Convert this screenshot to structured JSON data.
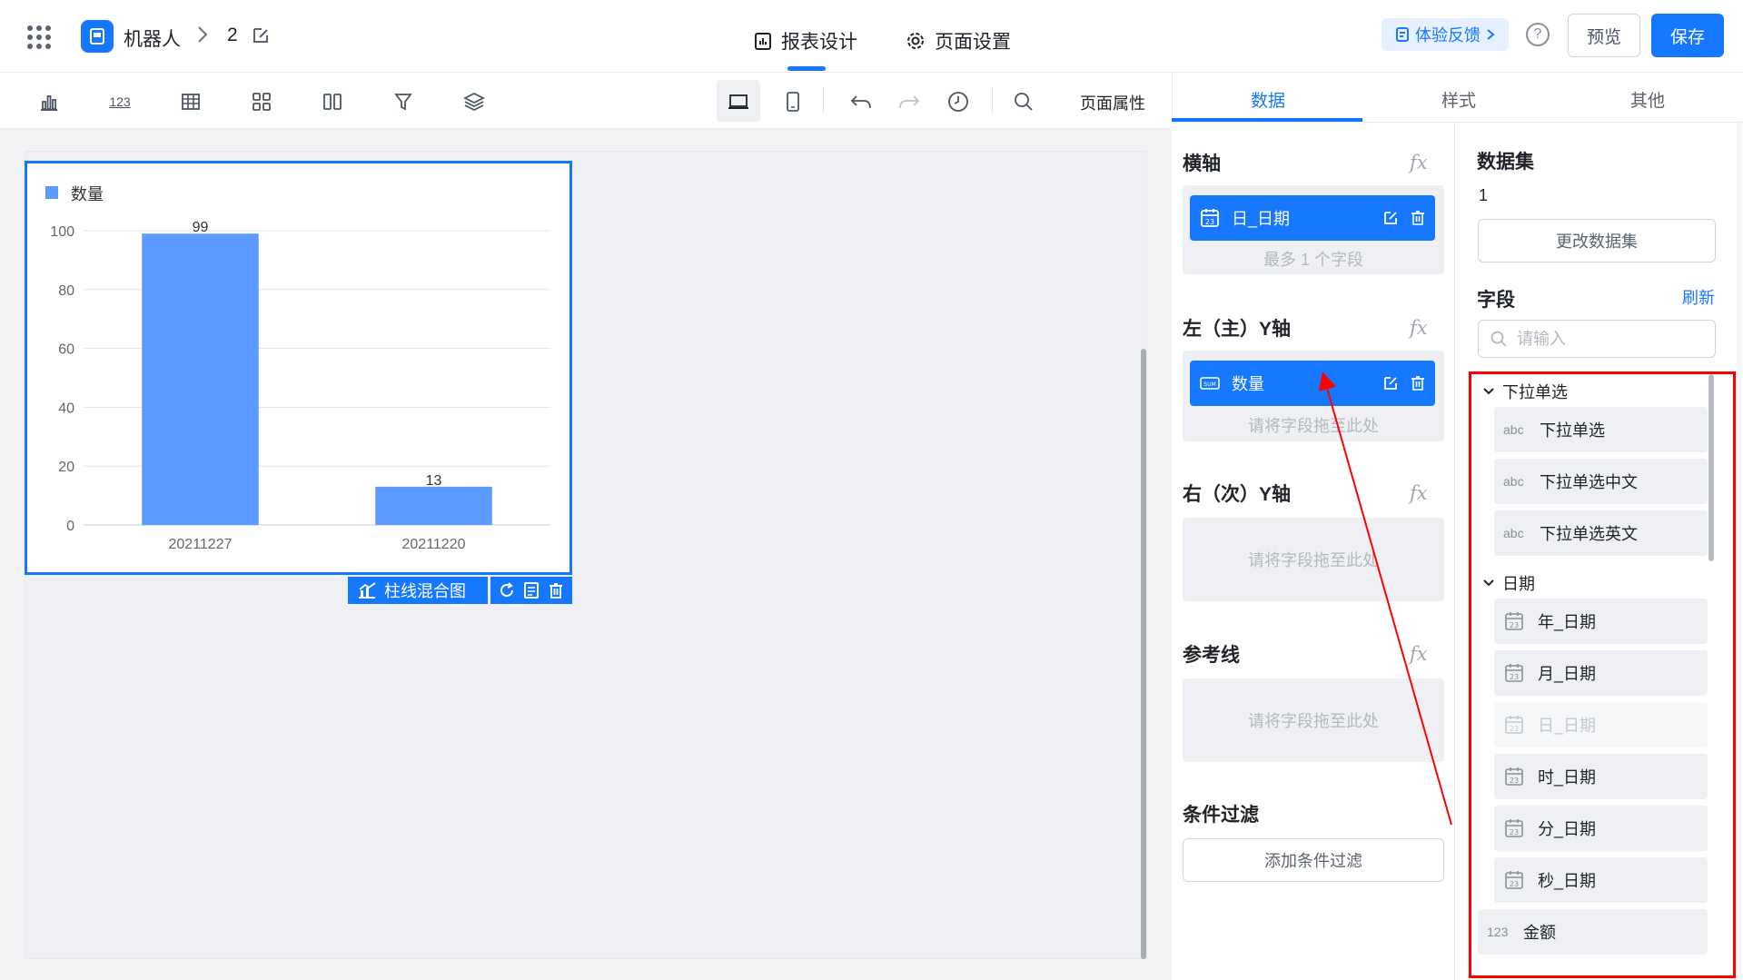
{
  "header": {
    "app_name": "机器人",
    "page_name": "2",
    "tabs": [
      {
        "label": "报表设计",
        "active": true
      },
      {
        "label": "页面设置",
        "active": false
      }
    ],
    "feedback_label": "体验反馈",
    "preview_label": "预览",
    "save_label": "保存"
  },
  "toolbar": {
    "page_props_label": "页面属性"
  },
  "chart": {
    "title": "",
    "legend": "数量",
    "toolbar_label": "柱线混合图",
    "chart_data": {
      "type": "bar",
      "categories": [
        "20211227",
        "20211220"
      ],
      "series": [
        {
          "name": "数量",
          "values": [
            99,
            13
          ]
        }
      ],
      "ylim": [
        0,
        100
      ],
      "yticks": [
        0,
        20,
        40,
        60,
        80,
        100
      ],
      "grid": true,
      "legend_position": "top-left",
      "color": "#5b9bff"
    }
  },
  "right_tabs": [
    {
      "label": "数据",
      "active": true
    },
    {
      "label": "样式",
      "active": false
    },
    {
      "label": "其他",
      "active": false
    }
  ],
  "axis": {
    "x_title": "横轴",
    "x_field": "日_日期",
    "x_hint": "最多 1 个字段",
    "left_y_title": "左（主）Y轴",
    "left_y_field": "数量",
    "left_y_hint": "请将字段拖至此处",
    "right_y_title": "右（次）Y轴",
    "right_y_hint": "请将字段拖至此处",
    "ref_title": "参考线",
    "ref_hint": "请将字段拖至此处",
    "filter_title": "条件过滤",
    "filter_button": "添加条件过滤",
    "fx": "fx"
  },
  "dataset": {
    "title": "数据集",
    "value": "1",
    "change_button": "更改数据集"
  },
  "fields": {
    "title": "字段",
    "refresh": "刷新",
    "search_placeholder": "请输入",
    "groups": [
      {
        "name": "下拉单选",
        "items": [
          {
            "tag": "abc",
            "label": "下拉单选"
          },
          {
            "tag": "abc",
            "label": "下拉单选中文"
          },
          {
            "tag": "abc",
            "label": "下拉单选英文"
          }
        ]
      },
      {
        "name": "日期",
        "items": [
          {
            "label": "年_日期",
            "disabled": false
          },
          {
            "label": "月_日期",
            "disabled": false
          },
          {
            "label": "日_日期",
            "disabled": true
          },
          {
            "label": "时_日期",
            "disabled": false
          },
          {
            "label": "分_日期",
            "disabled": false
          },
          {
            "label": "秒_日期",
            "disabled": false
          }
        ]
      }
    ],
    "amount": {
      "tag": "123",
      "label": "金额"
    }
  },
  "colors": {
    "primary": "#1677ff",
    "bar": "#5b9bff",
    "annotation": "#ff0000"
  }
}
